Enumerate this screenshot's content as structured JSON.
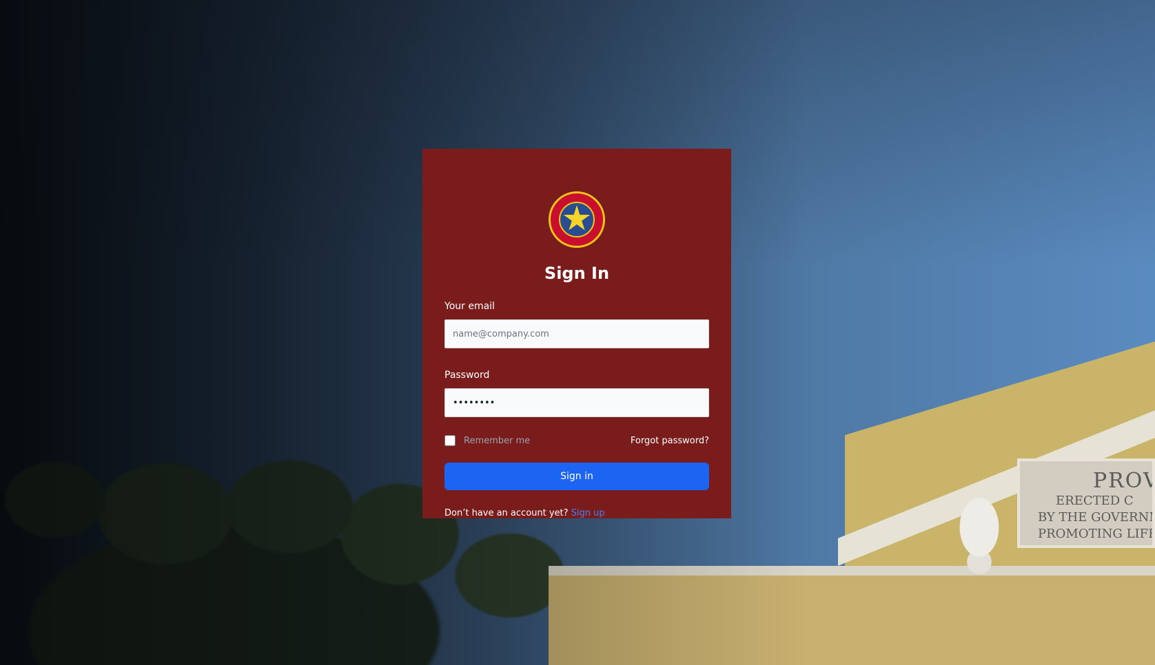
{
  "login": {
    "title": "Sign In",
    "seal_name": "seal-logo",
    "email_label": "Your email",
    "email_placeholder": "name@company.com",
    "password_label": "Password",
    "password_value": "••••••••",
    "remember_label": "Remember me",
    "remember_checked": false,
    "forgot_link": "Forgot password?",
    "submit_label": "Sign in",
    "no_account_text": "Don’t have an account yet?",
    "signup_link": "Sign up"
  },
  "background": {
    "plaque_lines": [
      "PROV",
      "ERECTED C",
      "BY THE GOVERNM",
      "PROMOTING LIFE"
    ]
  },
  "colors": {
    "card": "#791c1b",
    "primary_button": "#1c64f2",
    "link": "#3f83f8"
  }
}
